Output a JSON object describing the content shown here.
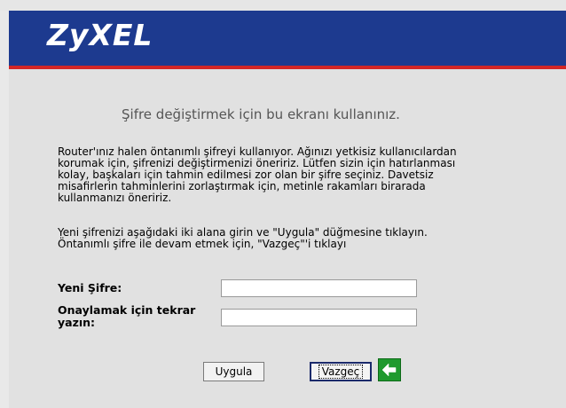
{
  "header": {
    "logo_text": "ZyXEL"
  },
  "page": {
    "title": "Şifre değiştirmek için bu ekranı kullanınız.",
    "paragraph1": [
      "Router'ınız halen öntanımlı şifreyi kullanıyor. Ağınızı yetkisiz kullanıcılardan",
      "korumak için, şifrenizi değiştirmenizi öneririz. Lütfen sizin için hatırlanması",
      "kolay, başkaları için tahmin edilmesi zor olan bir şifre seçiniz. Davetsiz",
      "misafirlerin tahminlerini zorlaştırmak için, metinle rakamları birarada",
      "kullanmanızı öneririz."
    ],
    "paragraph2": [
      "Yeni şifrenizi aşağıdaki iki alana girin ve \"Uygula\" düğmesine tıklayın.",
      "Öntanımlı şifre ile devam etmek için, \"Vazgeç\"'i tıklayı"
    ]
  },
  "form": {
    "new_password_label": "Yeni Şifre:",
    "confirm_password_label": "Onaylamak için tekrar yazın:",
    "new_password_value": "",
    "confirm_password_value": ""
  },
  "buttons": {
    "apply_label": "Uygula",
    "cancel_label": "Vazgeç",
    "back_icon": "green-back-arrow-icon"
  },
  "colors": {
    "header_blue": "#1d3a8f",
    "header_red": "#d32626",
    "background": "#e1e1e1",
    "arrow_green": "#1f9a2e"
  }
}
